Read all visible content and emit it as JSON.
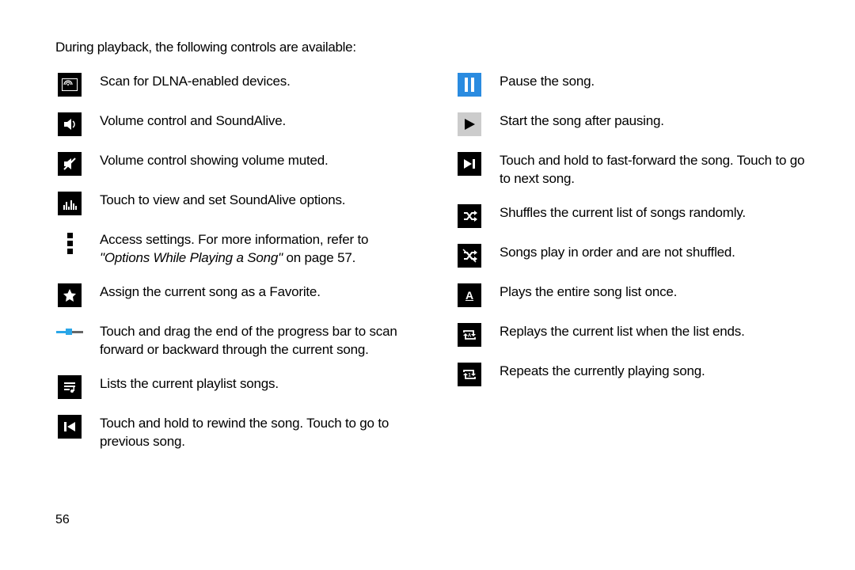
{
  "intro": "During playback, the following controls are available:",
  "page_number": "56",
  "left": [
    {
      "text": "Scan for DLNA-enabled devices."
    },
    {
      "text": "Volume control and SoundAlive."
    },
    {
      "text": "Volume control showing volume muted."
    },
    {
      "text": "Touch to view and set SoundAlive options."
    },
    {
      "text_a": "Access settings. For more information, refer to ",
      "text_italic": "\"Options While Playing a Song\"",
      "text_b": " on page 57."
    },
    {
      "text": "Assign the current song as a Favorite."
    },
    {
      "text": "Touch and drag the end of the progress bar to scan forward or backward through the current song."
    },
    {
      "text": "Lists the current playlist songs."
    },
    {
      "text": "Touch and hold to rewind the song. Touch to go to previous song."
    }
  ],
  "right": [
    {
      "text": "Pause the song."
    },
    {
      "text": "Start the song after pausing."
    },
    {
      "text": "Touch and hold to fast-forward the song. Touch to go to next song."
    },
    {
      "text": "Shuffles the current list of songs randomly."
    },
    {
      "text": "Songs play in order and are not shuffled."
    },
    {
      "text": "Plays the entire song list once."
    },
    {
      "text": "Replays the current list when the list ends."
    },
    {
      "text": "Repeats the currently playing song."
    }
  ]
}
